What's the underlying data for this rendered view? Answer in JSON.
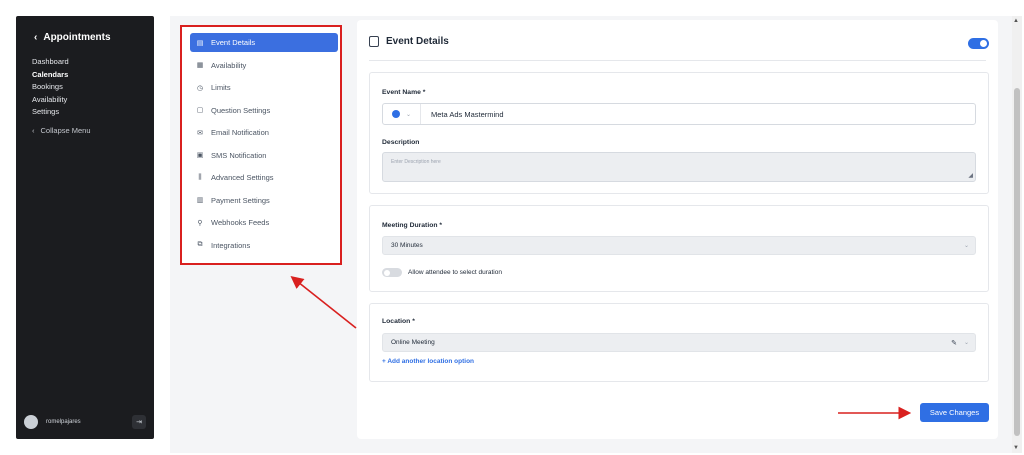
{
  "sidebar": {
    "back_label": "Appointments",
    "nav": [
      {
        "label": "Dashboard",
        "active": false
      },
      {
        "label": "Calendars",
        "active": true
      },
      {
        "label": "Bookings",
        "active": false
      },
      {
        "label": "Availability",
        "active": false
      },
      {
        "label": "Settings",
        "active": false
      }
    ],
    "collapse_label": "Collapse Menu",
    "username": "romelpajares"
  },
  "settings_menu": {
    "items": [
      {
        "label": "Event Details",
        "icon": "document-icon",
        "glyph": "▤",
        "active": true
      },
      {
        "label": "Availability",
        "icon": "calendar-icon",
        "glyph": "▦",
        "active": false
      },
      {
        "label": "Limits",
        "icon": "clock-icon",
        "glyph": "◷",
        "active": false
      },
      {
        "label": "Question Settings",
        "icon": "question-icon",
        "glyph": "▢",
        "active": false
      },
      {
        "label": "Email Notification",
        "icon": "mail-icon",
        "glyph": "✉",
        "active": false
      },
      {
        "label": "SMS Notification",
        "icon": "sms-icon",
        "glyph": "▣",
        "active": false
      },
      {
        "label": "Advanced Settings",
        "icon": "sliders-icon",
        "glyph": "⫼",
        "active": false
      },
      {
        "label": "Payment Settings",
        "icon": "payment-icon",
        "glyph": "▥",
        "active": false
      },
      {
        "label": "Webhooks Feeds",
        "icon": "link-icon",
        "glyph": "⚲",
        "active": false
      },
      {
        "label": "Integrations",
        "icon": "integrations-icon",
        "glyph": "⧉",
        "active": false
      }
    ]
  },
  "main": {
    "title": "Event Details",
    "enabled": true,
    "event_name": {
      "label": "Event Name *",
      "value": "Meta Ads Mastermind",
      "color": "#2f6fe4"
    },
    "description": {
      "label": "Description",
      "placeholder": "Enter Description here"
    },
    "meeting_duration": {
      "label": "Meeting Duration *",
      "value": "30 Minutes",
      "toggle_label": "Allow attendee to select duration",
      "toggle_on": false
    },
    "location": {
      "label": "Location *",
      "value": "Online Meeting",
      "add_link": "+ Add another location option"
    },
    "save_label": "Save Changes"
  },
  "colors": {
    "accent": "#2f6fe4",
    "annotation": "#d9201f",
    "sidebar_bg": "#1b1c1f"
  }
}
